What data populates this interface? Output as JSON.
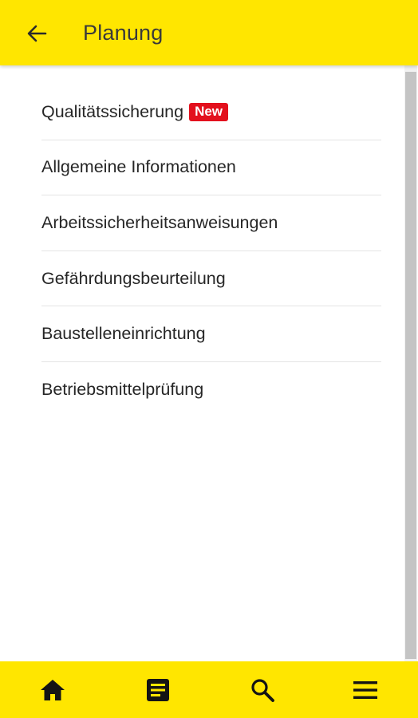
{
  "header": {
    "title": "Planung",
    "back_icon": "arrow-left-icon"
  },
  "menu": {
    "items": [
      {
        "label": "Qualitätssicherung",
        "badge": "New"
      },
      {
        "label": "Allgemeine Informationen"
      },
      {
        "label": "Arbeitssicherheitsanweisungen"
      },
      {
        "label": "Gefährdungsbeurteilung"
      },
      {
        "label": "Baustelleneinrichtung"
      },
      {
        "label": "Betriebsmittelprüfung"
      }
    ]
  },
  "bottom_nav": {
    "icons": [
      "home-icon",
      "document-icon",
      "search-icon",
      "menu-icon"
    ]
  },
  "colors": {
    "brand_yellow": "#ffe600",
    "badge_red": "#e3101d"
  }
}
